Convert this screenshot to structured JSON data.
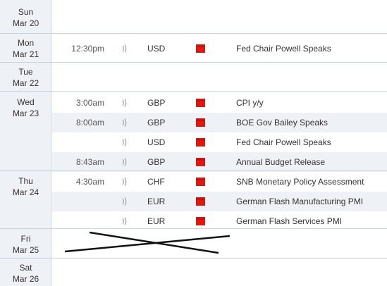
{
  "days": [
    {
      "weekday": "Sun",
      "date": "Mar 20",
      "events": []
    },
    {
      "weekday": "Mon",
      "date": "Mar 21",
      "events": [
        {
          "time": "12:30pm",
          "currency": "USD",
          "impact": "high",
          "title": "Fed Chair Powell Speaks"
        }
      ]
    },
    {
      "weekday": "Tue",
      "date": "Mar 22",
      "events": []
    },
    {
      "weekday": "Wed",
      "date": "Mar 23",
      "events": [
        {
          "time": "3:00am",
          "currency": "GBP",
          "impact": "high",
          "title": "CPI y/y"
        },
        {
          "time": "8:00am",
          "currency": "GBP",
          "impact": "high",
          "title": "BOE Gov Bailey Speaks"
        },
        {
          "time": "",
          "currency": "USD",
          "impact": "high",
          "title": "Fed Chair Powell Speaks"
        },
        {
          "time": "8:43am",
          "currency": "GBP",
          "impact": "high",
          "title": "Annual Budget Release"
        }
      ]
    },
    {
      "weekday": "Thu",
      "date": "Mar 24",
      "events": [
        {
          "time": "4:30am",
          "currency": "CHF",
          "impact": "high",
          "title": "SNB Monetary Policy Assessment"
        },
        {
          "time": "",
          "currency": "EUR",
          "impact": "high",
          "title": "German Flash Manufacturing PMI"
        },
        {
          "time": "",
          "currency": "EUR",
          "impact": "high",
          "title": "German Flash Services PMI"
        }
      ]
    },
    {
      "weekday": "Fri",
      "date": "Mar 25",
      "events": [],
      "crossed_out": true
    },
    {
      "weekday": "Sat",
      "date": "Mar 26",
      "events": []
    }
  ],
  "icons": {
    "sound": "sound-wave-icon",
    "impact_high": "red-folder-icon"
  },
  "colors": {
    "impact_high": "#e8150f",
    "row_alt": "#eef1f6",
    "border": "#c9d3de",
    "strike": "#111111"
  }
}
